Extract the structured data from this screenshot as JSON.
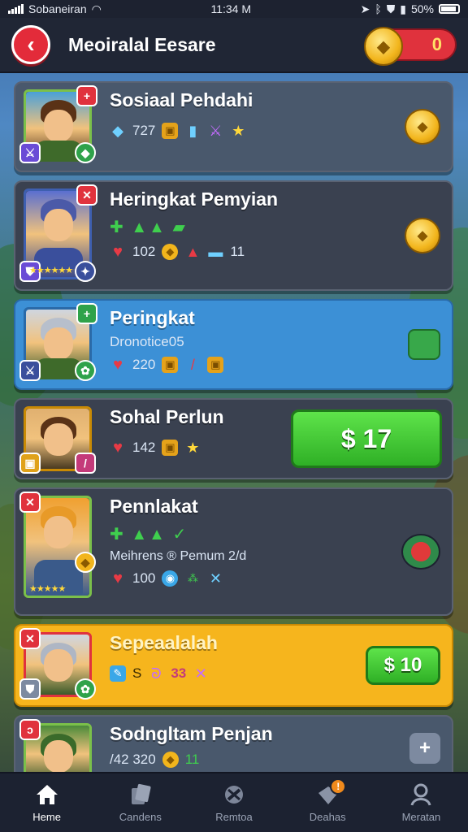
{
  "status_bar": {
    "carrier": "Sobaneiran",
    "time": "11:34 M",
    "battery": "50%"
  },
  "header": {
    "title": "Meoiralal Eesare",
    "coins": "0"
  },
  "cards": [
    {
      "name": "Sosiaal Pehdahi",
      "stats": [
        "727"
      ],
      "action": "coin"
    },
    {
      "name": "Heringkat Pemyian",
      "stats": [
        "102",
        "11"
      ],
      "action": "coin"
    },
    {
      "name": "Peringkat",
      "sub": "Dronotice05",
      "stats": [
        "220"
      ],
      "action": "green-box"
    },
    {
      "name": "Sohal Perlun",
      "stats": [
        "142"
      ],
      "action": "price",
      "price": "$ 17"
    },
    {
      "name": "Pennlakat",
      "sub": "Meihrens ® Pemum 2/d",
      "stats": [
        "100"
      ],
      "action": "potion"
    },
    {
      "name": "Sepeaalalah",
      "stats": [
        "S",
        "33"
      ],
      "action": "price",
      "price": "$ 10"
    },
    {
      "name": "Sodngltam Penjan",
      "stats": [
        "/42 320",
        "11"
      ],
      "action": "shield"
    }
  ],
  "nav": [
    {
      "label": "Heme",
      "icon": "home-icon"
    },
    {
      "label": "Candens",
      "icon": "cards-icon"
    },
    {
      "label": "Remtoa",
      "icon": "tools-icon"
    },
    {
      "label": "Deahas",
      "icon": "deals-icon",
      "badge": "!"
    },
    {
      "label": "Meratan",
      "icon": "profile-icon"
    }
  ],
  "colors": {
    "accent_red": "#e0323d",
    "accent_green": "#3fcf4e",
    "gold": "#f6b51d",
    "blue": "#3c90d6"
  }
}
